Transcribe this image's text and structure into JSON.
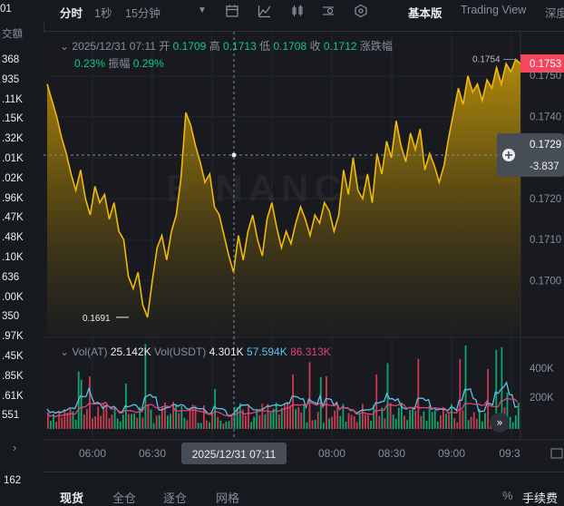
{
  "left_panel": {
    "top_value": "01",
    "header": "交額",
    "rows": [
      "368",
      "935",
      ".11K",
      ".15K",
      ".32K",
      ".01K",
      ".02K",
      ".96K",
      ".47K",
      ".48K",
      ".10K",
      "636",
      ".00K",
      "350",
      ".97K",
      ".45K",
      ".85K",
      ".61K",
      "551"
    ],
    "bottom_value": "162"
  },
  "toolbar": {
    "tab_time": "分时",
    "tab_1s": "1秒",
    "tab_15m": "15分钟",
    "basic": "基本版",
    "tv": "Trading View",
    "depth": "深度"
  },
  "ohlc": {
    "datetime": "2025/12/31 07:11",
    "open_label": "开",
    "open": "0.1709",
    "high_label": "高",
    "high": "0.1713",
    "low_label": "低",
    "low": "0.1708",
    "close_label": "收",
    "close": "0.1712",
    "change_label": "涨跌幅",
    "change": "0.23%",
    "amp_label": "振幅",
    "amp": "0.29%"
  },
  "volume": {
    "label1": "Vol(AT)",
    "val1": "25.142K",
    "label2": "Vol(USDT)",
    "val2": "4.301K",
    "ma1": "57.594K",
    "ma2": "86.313K"
  },
  "price_axis": {
    "current": "0.1753",
    "crosshair": "0.1729",
    "crosshair_sub": "-3.837"
  },
  "volume_axis": [
    "400K",
    "200K"
  ],
  "crosshair_time": "2025/12/31 07:11",
  "bottom_tabs": [
    "现货",
    "全仓",
    "逐仓",
    "网格"
  ],
  "bottom_right": "手续费",
  "watermark": "BINANCE",
  "colors": {
    "line": "#f0b90b",
    "up": "#0ecb81",
    "down": "#f6465d",
    "ma1": "#5dc3e8",
    "ma2": "#e0447a"
  },
  "chart_data": {
    "type": "area",
    "x_ticks": [
      "06:00",
      "06:30",
      "08:00",
      "08:30",
      "09:00",
      "09:3"
    ],
    "y_ticks": [
      0.174,
      0.172,
      0.171,
      0.17,
      0.173
    ],
    "y_tick_labels": [
      "0.1740",
      "0.1720",
      "0.1710",
      "0.1700",
      "0.1730"
    ],
    "ylim": [
      0.1687,
      0.1757
    ],
    "annotations": [
      {
        "label": "0.1754",
        "value": 0.1754
      },
      {
        "label": "0.1691",
        "value": 0.1691
      }
    ],
    "values": [
      0.1748,
      0.1744,
      0.174,
      0.1735,
      0.1731,
      0.1726,
      0.1722,
      0.1727,
      0.172,
      0.1716,
      0.1723,
      0.1719,
      0.1721,
      0.1715,
      0.1719,
      0.1712,
      0.171,
      0.1701,
      0.1698,
      0.1702,
      0.1694,
      0.1691,
      0.17,
      0.1708,
      0.1711,
      0.1705,
      0.1712,
      0.1716,
      0.1725,
      0.1741,
      0.1738,
      0.1733,
      0.1729,
      0.1724,
      0.1726,
      0.1718,
      0.1716,
      0.1711,
      0.1706,
      0.1702,
      0.1711,
      0.1705,
      0.1712,
      0.1716,
      0.171,
      0.1706,
      0.1715,
      0.1719,
      0.1713,
      0.1708,
      0.1712,
      0.1709,
      0.1714,
      0.1718,
      0.1715,
      0.1711,
      0.1716,
      0.1714,
      0.1719,
      0.1717,
      0.1712,
      0.1716,
      0.1727,
      0.1721,
      0.173,
      0.1722,
      0.172,
      0.1726,
      0.1719,
      0.1731,
      0.1726,
      0.1734,
      0.173,
      0.1739,
      0.1733,
      0.1729,
      0.1736,
      0.1732,
      0.1737,
      0.1727,
      0.1731,
      0.1728,
      0.1724,
      0.1728,
      0.1735,
      0.1741,
      0.1747,
      0.1743,
      0.175,
      0.1746,
      0.1748,
      0.1744,
      0.1749,
      0.1747,
      0.1752,
      0.1748,
      0.1753,
      0.1751,
      0.1754,
      0.1753
    ]
  }
}
